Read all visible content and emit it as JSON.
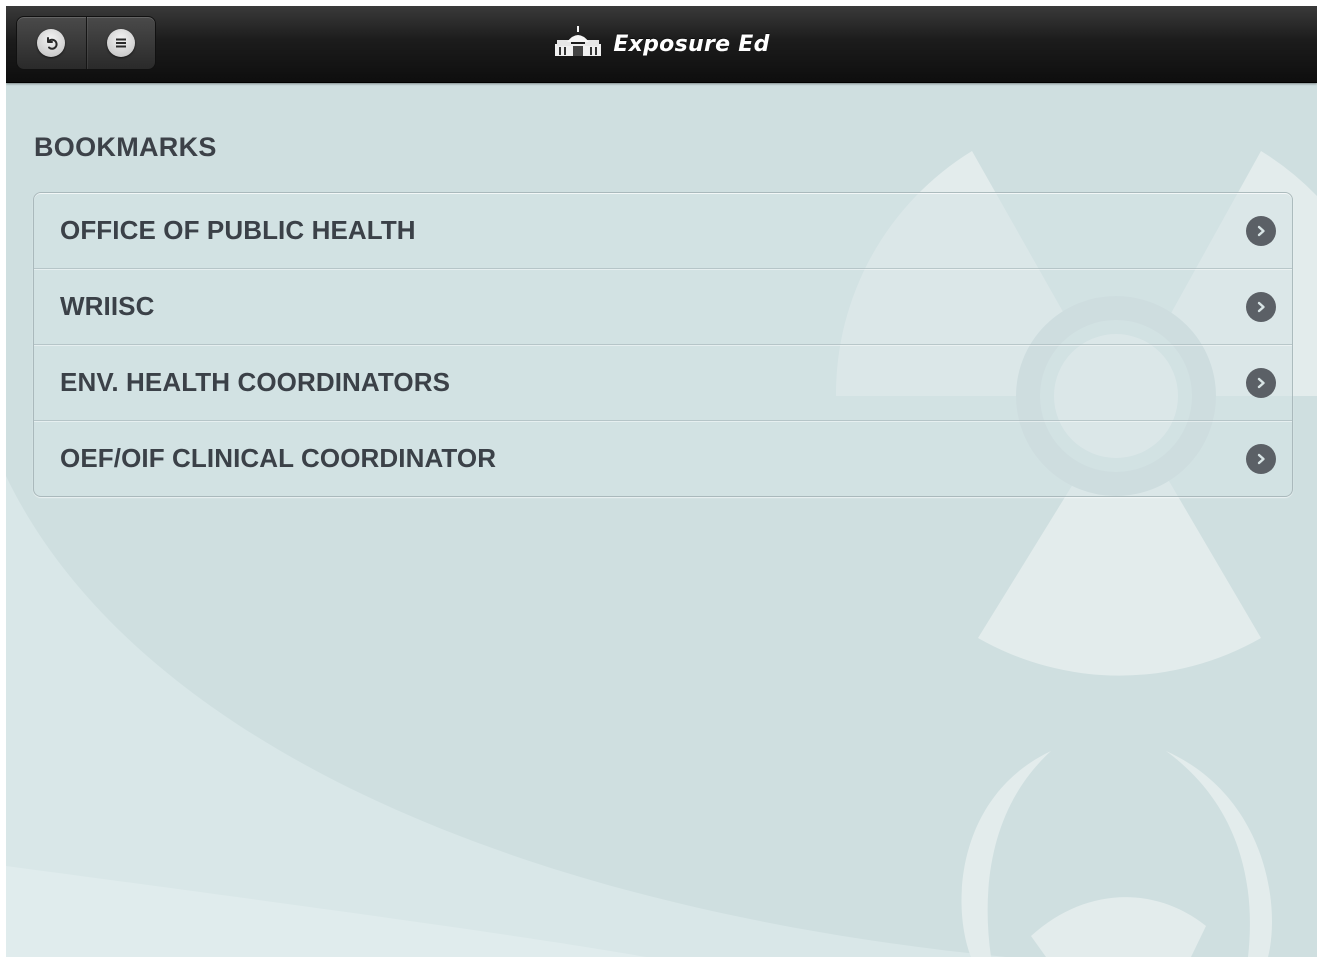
{
  "app": {
    "title": "Exposure Ed"
  },
  "toolbar": {
    "back_icon": "back-arrow-icon",
    "menu_icon": "menu-list-icon",
    "logo_icon": "capitol-logo-icon"
  },
  "page": {
    "section_title": "BOOKMARKS"
  },
  "bookmarks": {
    "items": [
      {
        "label": "OFFICE OF PUBLIC HEALTH",
        "icon": "chevron-right-circle-icon"
      },
      {
        "label": "WRIISC",
        "icon": "chevron-right-circle-icon"
      },
      {
        "label": "ENV. HEALTH COORDINATORS",
        "icon": "chevron-right-circle-icon"
      },
      {
        "label": "OEF/OIF CLINICAL COORDINATOR",
        "icon": "chevron-right-circle-icon"
      }
    ]
  },
  "colors": {
    "background": "#cfdfe0",
    "topbar": "#1c1c1c",
    "text": "#3b4148",
    "chevron": "#5b6066"
  }
}
